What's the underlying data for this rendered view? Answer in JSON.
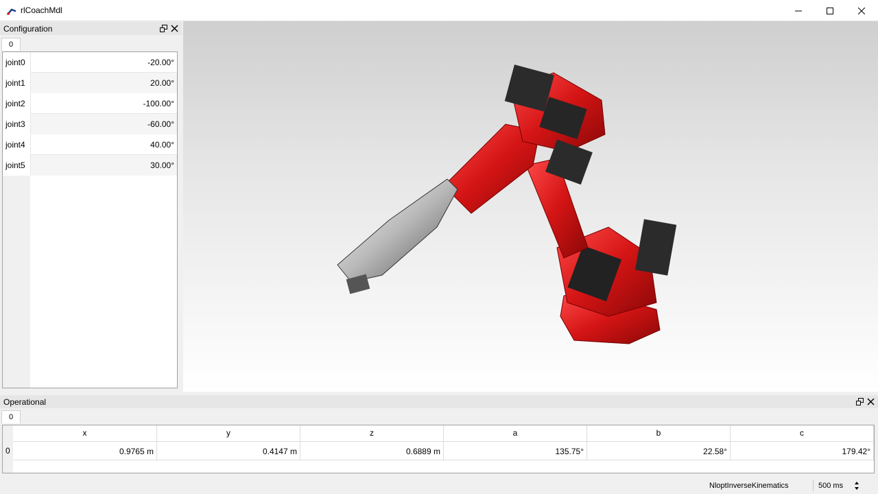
{
  "window": {
    "title": "rlCoachMdl",
    "icons": {
      "app": "robot-arm-icon",
      "minimize": "minimize-icon",
      "maximize": "maximize-icon",
      "close": "close-icon"
    }
  },
  "configuration": {
    "title": "Configuration",
    "tab": "0",
    "joints": [
      {
        "name": "joint0",
        "value": "-20.00°"
      },
      {
        "name": "joint1",
        "value": "20.00°"
      },
      {
        "name": "joint2",
        "value": "-100.00°"
      },
      {
        "name": "joint3",
        "value": "-60.00°"
      },
      {
        "name": "joint4",
        "value": "40.00°"
      },
      {
        "name": "joint5",
        "value": "30.00°"
      }
    ]
  },
  "operational": {
    "title": "Operational",
    "tab": "0",
    "row_label": "0",
    "columns": [
      {
        "header": "x",
        "value": "0.9765 m"
      },
      {
        "header": "y",
        "value": "0.4147 m"
      },
      {
        "header": "z",
        "value": "0.6889 m"
      },
      {
        "header": "a",
        "value": "135.75°"
      },
      {
        "header": "b",
        "value": "22.58°"
      },
      {
        "header": "c",
        "value": "179.42°"
      }
    ]
  },
  "statusbar": {
    "plugin": "NloptInverseKinematics",
    "interval": "500 ms"
  },
  "colors": {
    "robot": "#d41414",
    "viewer_top": "#cfcfcf",
    "viewer_bottom": "#ffffff"
  }
}
